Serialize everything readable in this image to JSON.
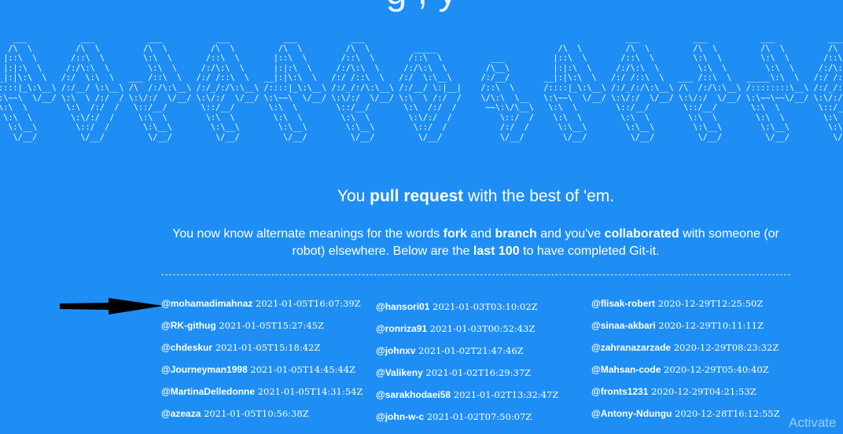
{
  "heading": {
    "partial_title": "g , y"
  },
  "ascii_art": "    ___           ___           ___           ___           ___           ___                                                      ___           ___           ___           ___\n   /\\  \\         /\\  \\         /\\  \\         /\\  \\         /\\  \\         /\\  \\         _____                         /\\  \\         /\\  \\         /\\  \\         /\\  \\         /\\  \\\n  |::\\  \\       /::\\  \\        \\:\\  \\       /::\\  \\       |::\\  \\       /::\\  \\       /::\\  \\          ___          |::\\  \\       /::\\  \\        \\:\\  \\        \\:\\  \\       /::\\  \\\n  |:|:\\  \\     /:/\\:\\  \\        \\:\\  \\     /:/\\:\\  \\      |:|:\\  \\     /:/\\:\\  \\     /:/\\:\\  \\        /\\__\\         |:|:\\  \\     /:/\\:\\  \\        \\:\\  \\        \\:\\  \\     /:/\\:\\  \\\n__|:|\\:\\  \\   /:/  \\:\\  \\   ___ /::\\  \\   /:/ /::\\  \\   __|:|\\:\\  \\   /:/ /::\\  \\   /:/  \\:\\__\\      /:/__/       __|:|\\:\\  \\   /:/ /::\\  \\   ___ /::\\  \\   _____\\:\\  \\   /:/ /::\\  \\\n/::::|_\\:\\__\\ /:/__/ \\:\\__\\ /\\  /:/\\:\\__\\ /:/_/:/\\:\\__\\ /::::|_\\:\\__\\ /:/_/:/\\:\\__\\ /:/__/ \\:|__|    /::\\  \\      /::::|_\\:\\__\\ /:/_/:/\\:\\__\\ /\\  /:/\\:\\__\\ /::::::::\\__\\ /:/_/:/\\:\\__\\\n\\:\\~~\\  \\/__/ \\:\\  \\ /:/  / \\:\\/:/  \\/__/ \\:\\/:/  \\/__/ \\:\\~~\\  \\/__/ \\:\\/:/  \\/__/ \\:\\  \\ /:/  /    \\/\\:\\  \\__   \\:\\~~\\  \\/__/ \\:\\/:/  \\/__/ \\:\\/:/  \\/__/ \\:\\~~\\~~\\/__/ \\:\\/:/  \\/__/\n \\:\\  \\        \\:\\  /:/  /   \\::/__/       \\::/__/       \\:\\  \\        \\::/__/       \\:\\  /:/  /      ~~\\:\\/\\__\\   \\:\\  \\        \\::/__/       \\::/__/       \\:\\  \\        \\::/__/\n  \\:\\  \\        \\:\\/:/  /     \\:\\  \\        \\:\\  \\        \\:\\  \\        \\:\\  \\        \\:\\/:/  /          \\::/  /    \\:\\  \\        \\:\\  \\        \\:\\  \\        \\:\\  \\        \\:\\  \\\n   \\:\\__\\        \\::/  /       \\:\\__\\        \\:\\__\\        \\:\\__\\        \\:\\__\\        \\::/  /           /:/  /      \\:\\__\\        \\:\\__\\        \\:\\__\\        \\:\\__\\        \\:\\__\\\n    \\/__/         \\/__/         \\/__/         \\/__/         \\/__/         \\/__/         \\/__/            \\/__/        \\/__/         \\/__/         \\/__/         \\/__/         \\/__/",
  "tagline": {
    "pre": "You ",
    "bold": "pull request",
    "post": " with the best of 'em."
  },
  "description": {
    "p1": "You now know alternate meanings for the words ",
    "b1": "fork",
    "p2": " and ",
    "b2": "branch",
    "p3": " and you've ",
    "b3": "collaborated",
    "p4": " with someone (or robot) elsewhere. Below are the ",
    "b4": "last 100",
    "p5": " to have completed Git-it."
  },
  "contributors": {
    "column_1": [
      {
        "user": "@mohamadimahnaz",
        "time": "2021-01-05T16:07:39Z"
      },
      {
        "user": "@RK-githug",
        "time": "2021-01-05T15:27:45Z"
      },
      {
        "user": "@chdeskur",
        "time": "2021-01-05T15:18:42Z"
      },
      {
        "user": "@Journeyman1998",
        "time": "2021-01-05T14:45:44Z"
      },
      {
        "user": "@MartinaDelledonne",
        "time": "2021-01-05T14:31:54Z"
      },
      {
        "user": "@azeaza",
        "time": "2021-01-05T10:56:38Z"
      }
    ],
    "column_2": [
      {
        "user": "@hansori01",
        "time": "2021-01-03T03:10:02Z"
      },
      {
        "user": "@ronriza91",
        "time": "2021-01-03T00:52:43Z"
      },
      {
        "user": "@johnxv",
        "time": "2021-01-02T21:47:46Z"
      },
      {
        "user": "@Valikeny",
        "time": "2021-01-02T16:29:37Z"
      },
      {
        "user": "@sarakhodaei58",
        "time": "2021-01-02T13:32:47Z"
      },
      {
        "user": "@john-w-c",
        "time": "2021-01-02T07:50:07Z"
      }
    ],
    "column_3": [
      {
        "user": "@flisak-robert",
        "time": "2020-12-29T12:25:50Z"
      },
      {
        "user": "@sinaa-akbari",
        "time": "2020-12-29T10:11:11Z"
      },
      {
        "user": "@zahranazarzade",
        "time": "2020-12-29T08:23:32Z"
      },
      {
        "user": "@Mahsan-code",
        "time": "2020-12-29T05:40:40Z"
      },
      {
        "user": "@fronts1231",
        "time": "2020-12-29T04:21:53Z"
      },
      {
        "user": "@Antony-Ndungu",
        "time": "2020-12-28T16:12:55Z"
      }
    ]
  },
  "watermark": "Activate",
  "colors": {
    "background": "#1e8ef5",
    "text": "#ffffff",
    "arrow": "#000000"
  }
}
